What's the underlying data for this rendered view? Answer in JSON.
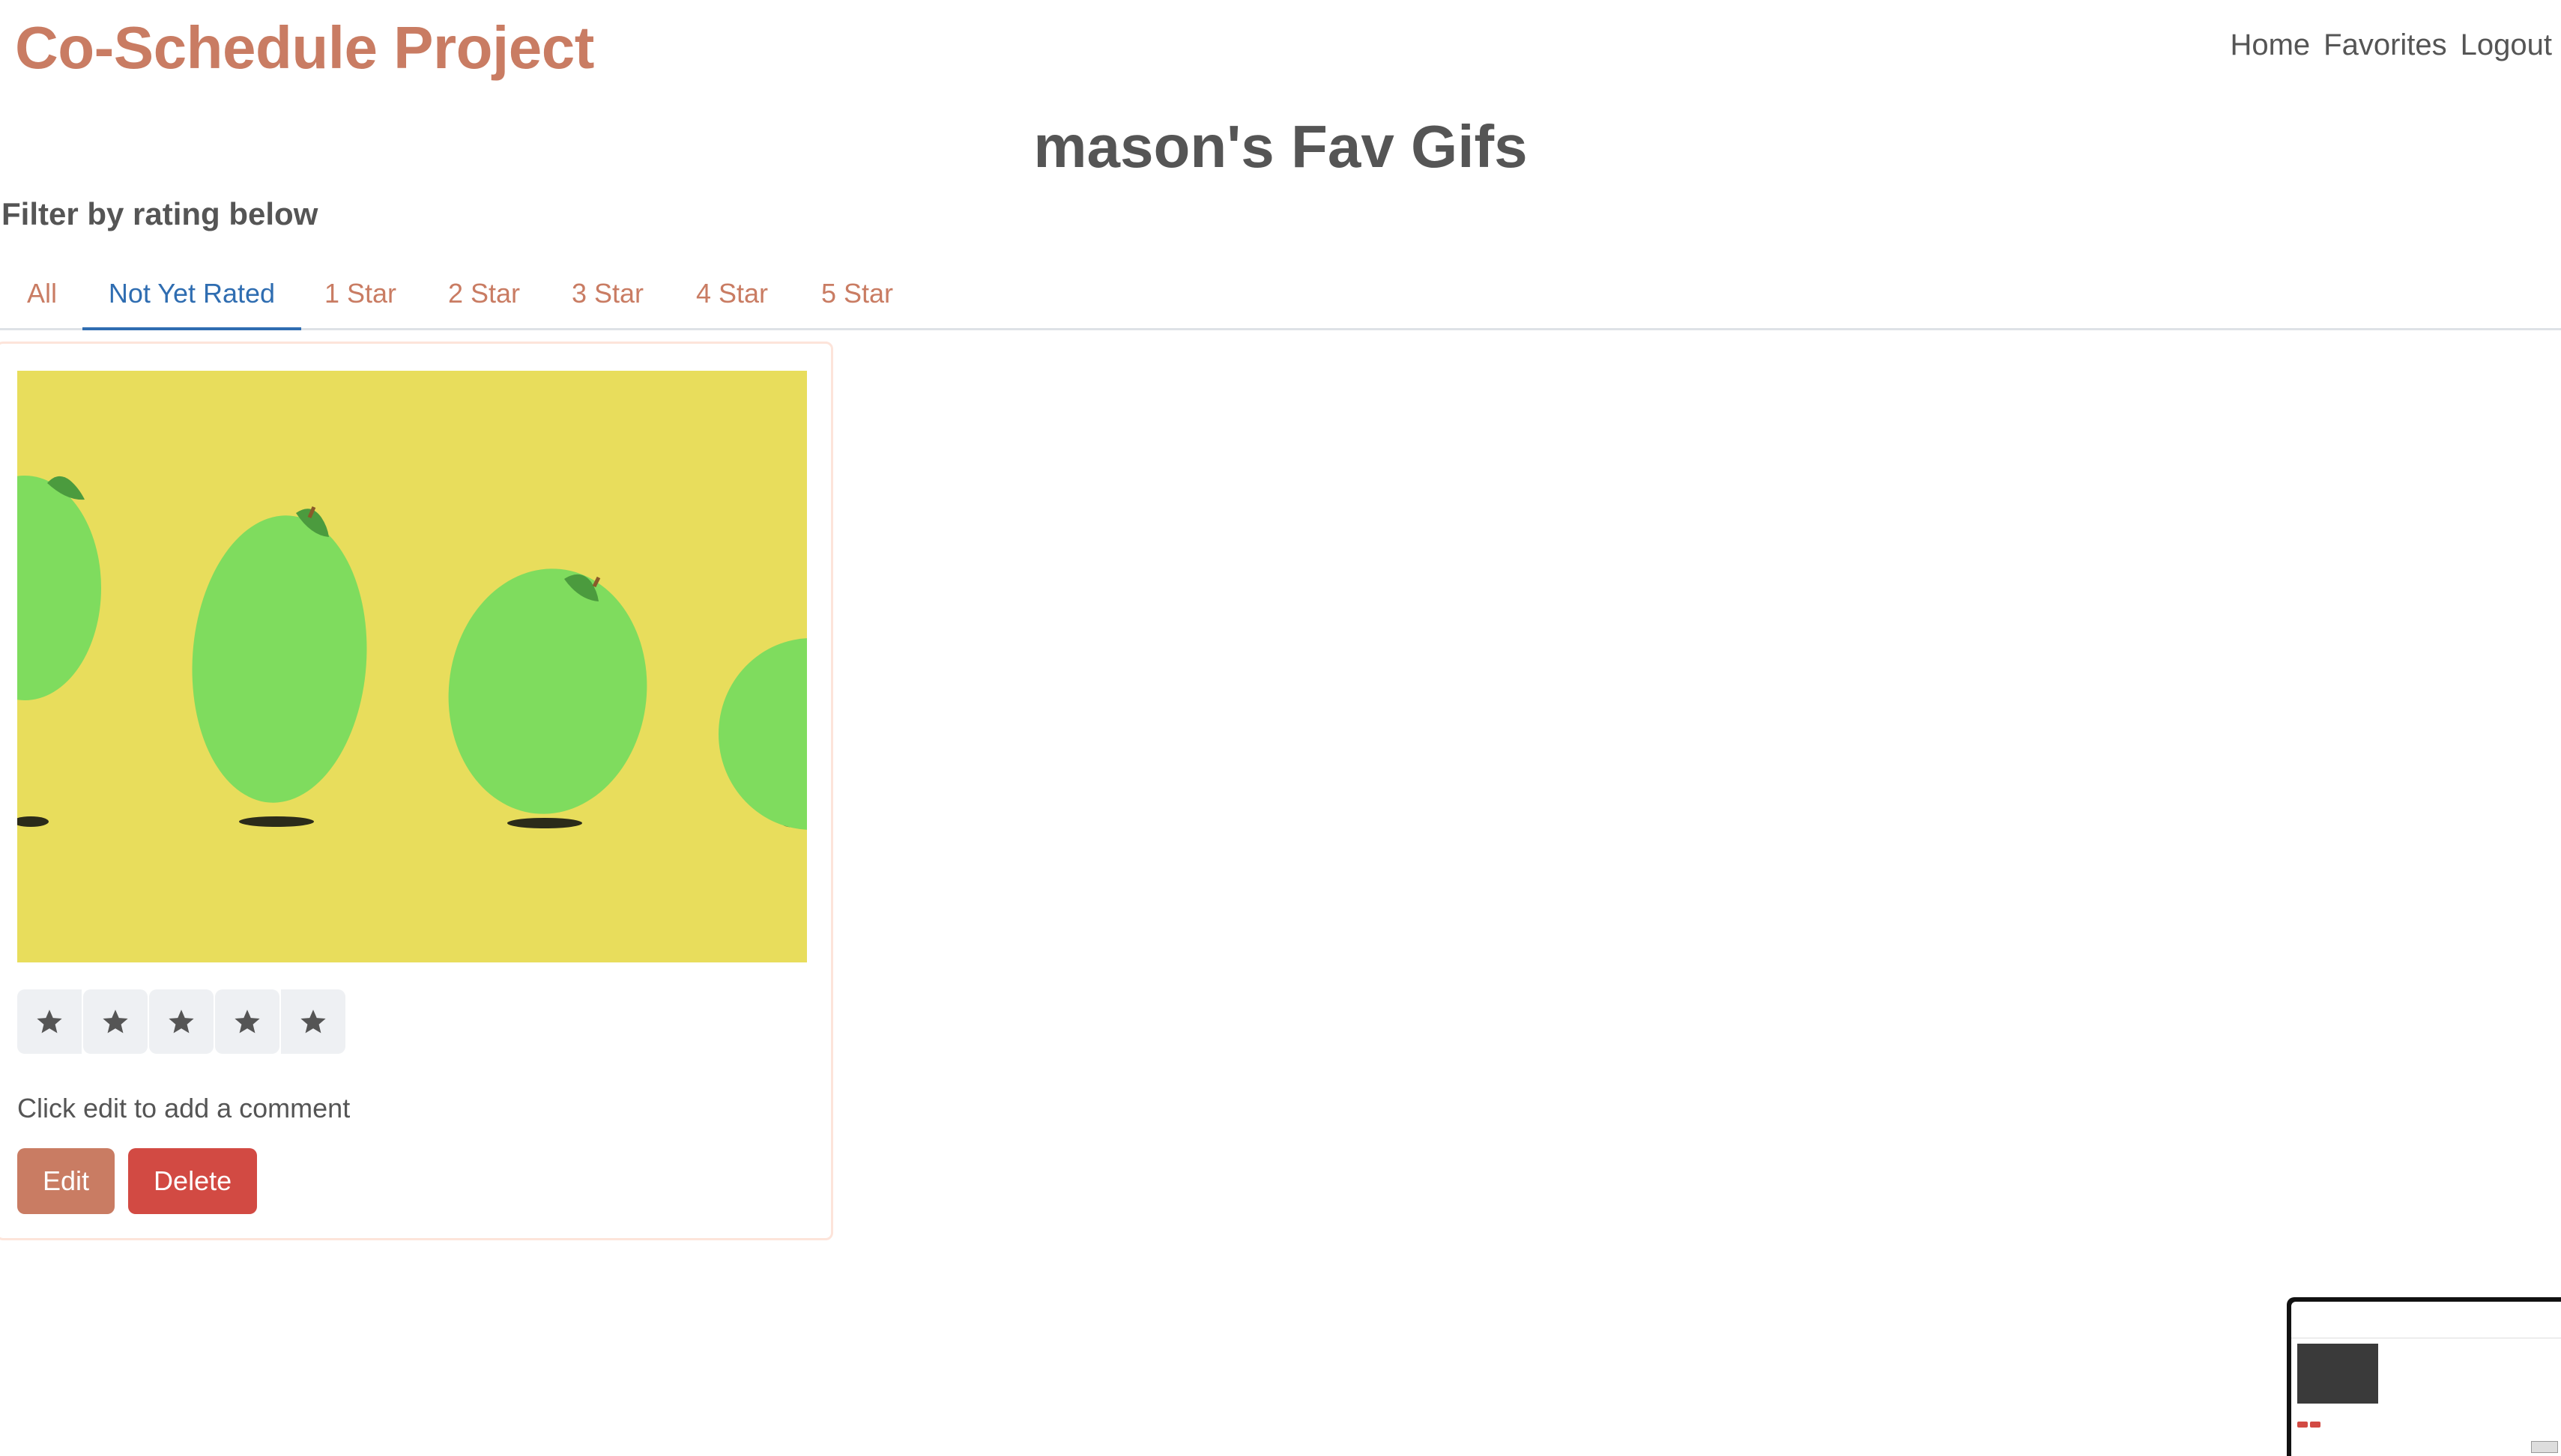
{
  "header": {
    "brand": "Co-Schedule Project",
    "nav": [
      "Home",
      "Favorites",
      "Logout"
    ]
  },
  "page_title": "mason's Fav Gifs",
  "filter_label": "Filter by rating below",
  "tabs": {
    "items": [
      "All",
      "Not Yet Rated",
      "1 Star",
      "2 Star",
      "3 Star",
      "4 Star",
      "5 Star"
    ],
    "active": "Not Yet Rated"
  },
  "card": {
    "gif_icon": "bouncing-green-fruits-gif",
    "rating_icon": "star-icon",
    "rating_max": 5,
    "rating_value": 0,
    "comment": "Click edit to add a comment",
    "edit_label": "Edit",
    "delete_label": "Delete"
  },
  "colors": {
    "brand": "#c97c63",
    "active_tab": "#2f6db1",
    "delete": "#d24a43",
    "gif_background": "#e8dd5c"
  }
}
